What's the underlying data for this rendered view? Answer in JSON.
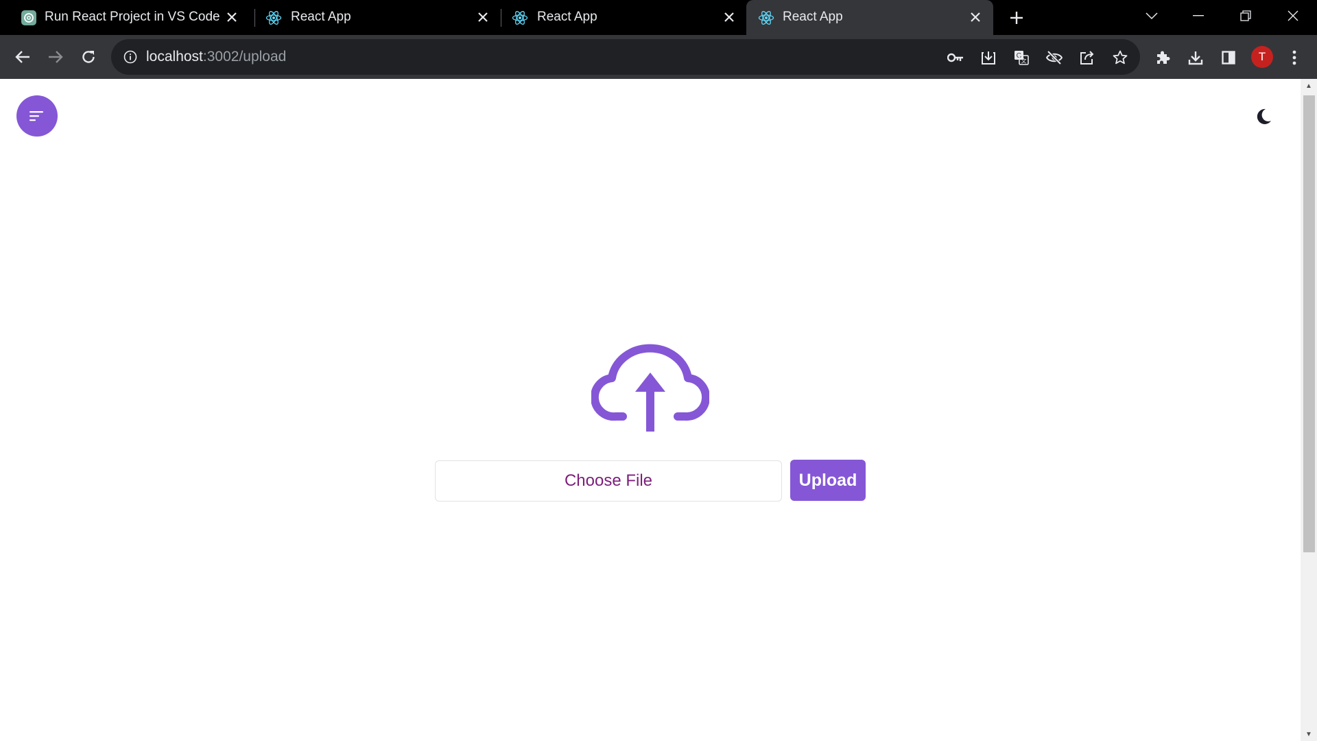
{
  "browser": {
    "tabs": [
      {
        "title": "Run React Project in VS Code",
        "icon": "chatgpt-icon",
        "active": false
      },
      {
        "title": "React App",
        "icon": "react-icon",
        "active": false
      },
      {
        "title": "React App",
        "icon": "react-icon",
        "active": false
      },
      {
        "title": "React App",
        "icon": "react-icon",
        "active": true
      }
    ],
    "address": {
      "host": "localhost",
      "rest": ":3002/upload"
    },
    "profile_initial": "T"
  },
  "page": {
    "choose_file_label": "Choose File",
    "upload_label": "Upload"
  },
  "colors": {
    "accent": "#8557d6",
    "choose_file_text": "#7b1e7a",
    "tab_bar": "#000000",
    "toolbar": "#35363a",
    "omnibox": "#202124",
    "avatar": "#c5221f"
  }
}
